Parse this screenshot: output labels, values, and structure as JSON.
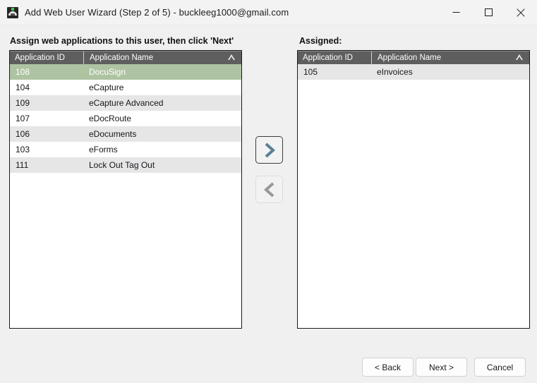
{
  "window": {
    "title": "Add Web User Wizard (Step 2 of 5) - buckleeg1000@gmail.com",
    "icon": "app-logo-icon",
    "controls": {
      "minimize": "minimize-icon",
      "maximize": "maximize-icon",
      "close": "close-icon"
    }
  },
  "instruction": "Assign web applications to this user, then click 'Next'",
  "assigned_label": "Assigned:",
  "columns": {
    "id": "Application ID",
    "name": "Application Name",
    "sort_indicator": "sort-ascending-icon"
  },
  "available_list": {
    "rows": [
      {
        "id": "108",
        "name": "DocuSign",
        "selected": true
      },
      {
        "id": "104",
        "name": "eCapture",
        "selected": false
      },
      {
        "id": "109",
        "name": "eCapture Advanced",
        "selected": false
      },
      {
        "id": "107",
        "name": "eDocRoute",
        "selected": false
      },
      {
        "id": "106",
        "name": "eDocuments",
        "selected": false
      },
      {
        "id": "103",
        "name": "eForms",
        "selected": false
      },
      {
        "id": "111",
        "name": "Lock Out Tag Out",
        "selected": false
      }
    ]
  },
  "assigned_list": {
    "rows": [
      {
        "id": "105",
        "name": "eInvoices",
        "selected": false
      }
    ]
  },
  "transfer": {
    "move_right": "chevron-right-icon",
    "move_left": "chevron-left-icon"
  },
  "footer": {
    "back": "< Back",
    "next": "Next >",
    "cancel": "Cancel"
  },
  "colors": {
    "selection_green": "#aec3a2",
    "header_gray": "#5e5e5e",
    "row_alt": "#e6e6e6",
    "window_bg": "#f0f0f0",
    "titlebar_bg": "#f3f3f3",
    "chevron_right": "#5b7f96",
    "chevron_left": "#989898"
  }
}
